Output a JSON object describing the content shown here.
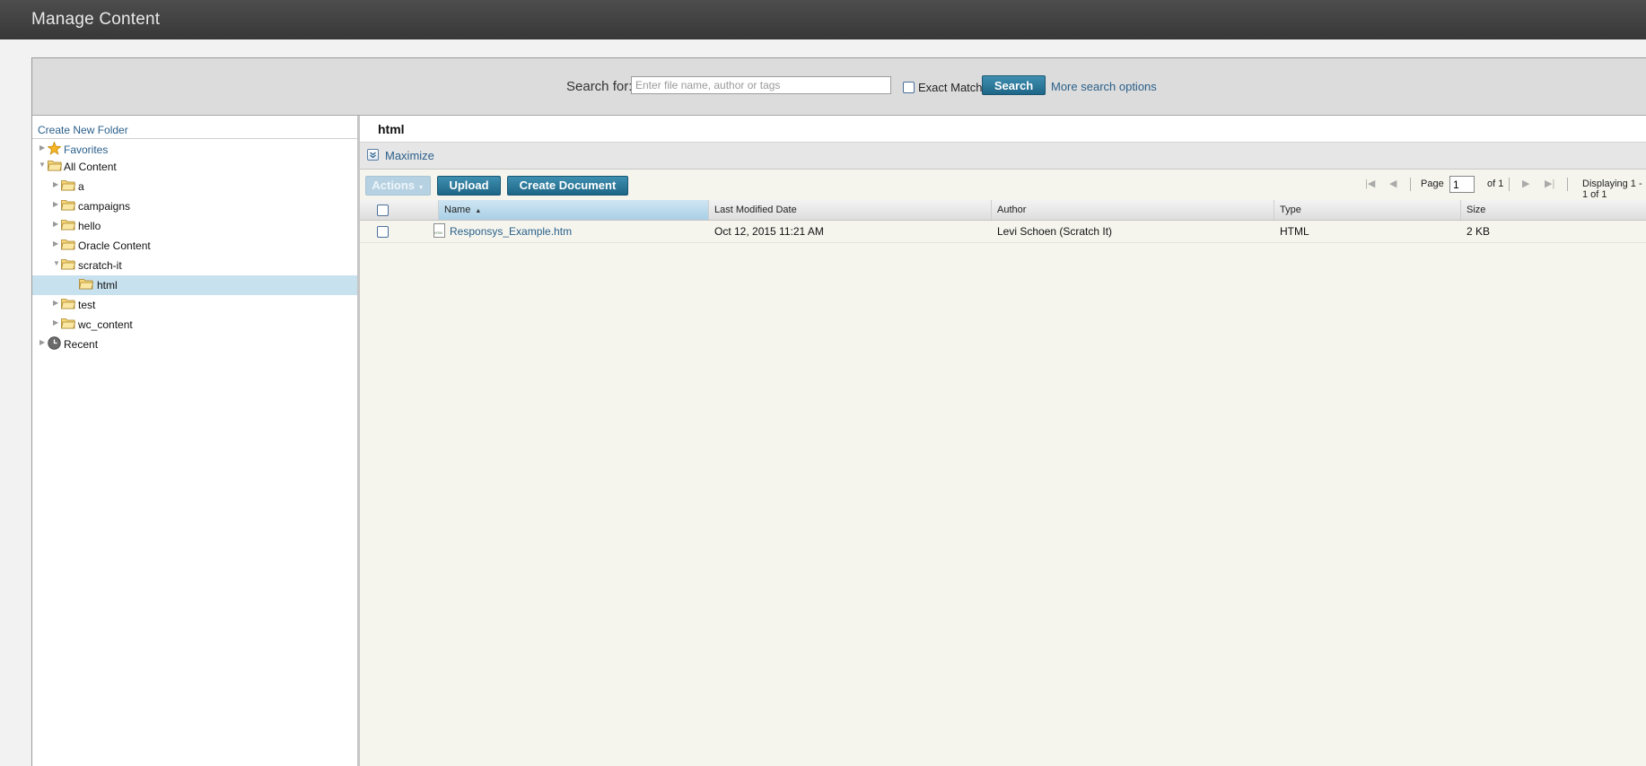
{
  "header": {
    "title": "Manage Content"
  },
  "search": {
    "label": "Search for:",
    "placeholder": "Enter file name, author or tags",
    "exact_match_label": "Exact Match",
    "button_label": "Search",
    "more_options_label": "More search options"
  },
  "sidebar": {
    "create_folder_label": "Create New Folder",
    "tree": [
      {
        "label": "Favorites",
        "icon": "star-icon"
      },
      {
        "label": "All Content",
        "icon": "folder-icon"
      },
      {
        "label": "a",
        "icon": "folder-icon"
      },
      {
        "label": "campaigns",
        "icon": "folder-icon"
      },
      {
        "label": "hello",
        "icon": "folder-icon"
      },
      {
        "label": "Oracle Content",
        "icon": "folder-icon"
      },
      {
        "label": "scratch-it",
        "icon": "folder-icon"
      },
      {
        "label": "html",
        "icon": "folder-icon",
        "selected": true
      },
      {
        "label": "test",
        "icon": "folder-icon"
      },
      {
        "label": "wc_content",
        "icon": "folder-icon"
      },
      {
        "label": "Recent",
        "icon": "clock-icon"
      }
    ]
  },
  "main": {
    "current_folder": "html",
    "maximize_label": "Maximize",
    "toolbar": {
      "actions_label": "Actions",
      "upload_label": "Upload",
      "create_document_label": "Create Document"
    },
    "pager": {
      "page_label": "Page",
      "page_value": "1",
      "of_label": "of 1",
      "display_label": "Displaying 1 - 1 of 1"
    },
    "columns": [
      "Name",
      "Last Modified Date",
      "Author",
      "Type",
      "Size"
    ],
    "rows": [
      {
        "name": "Responsys_Example.htm",
        "modified": "Oct 12, 2015 11:21 AM",
        "author": "Levi Schoen (Scratch It)",
        "type": "HTML",
        "size": "2 KB"
      }
    ]
  },
  "colors": {
    "accent": "#1e6687",
    "link": "#2a5f8a",
    "selected_row": "#c8e1ef",
    "topbar": "#3f3f3f"
  }
}
